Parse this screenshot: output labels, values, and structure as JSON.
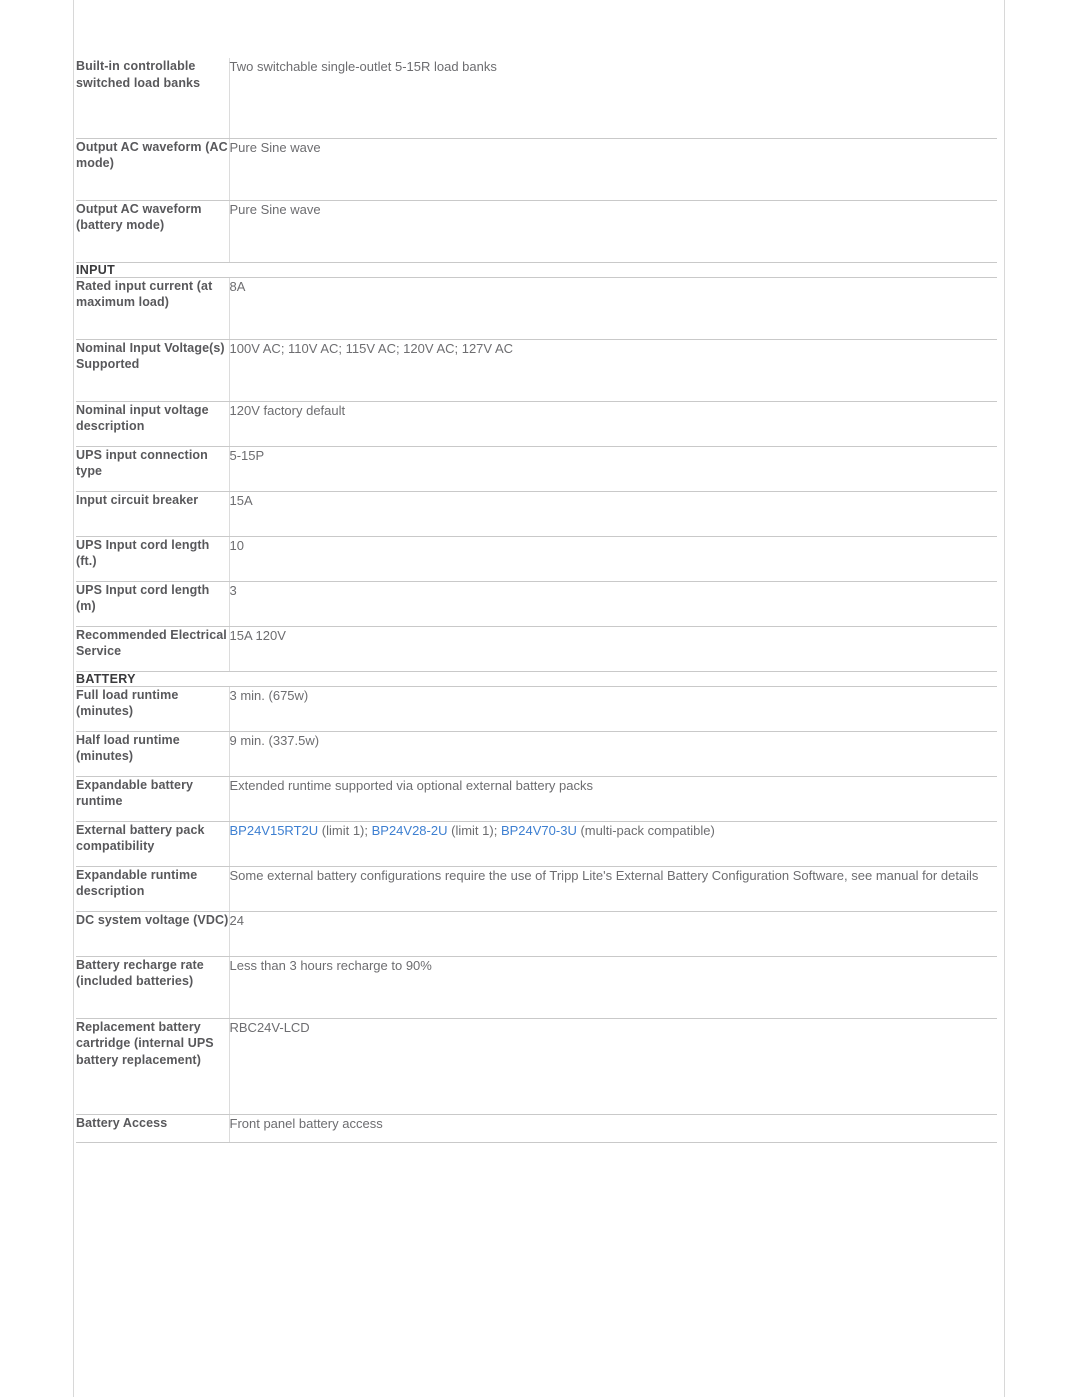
{
  "document": {
    "type": "product-specification-table",
    "accent_link_color": "#3d7fd1",
    "label_color": "#58585b",
    "value_color": "#6d6d70",
    "section_color": "#3a3a3c",
    "border_color": "#c9c9c9"
  },
  "rows": [
    {
      "kind": "data",
      "label": "Built-in controllable switched load banks",
      "value": "Two switchable single-outlet 5-15R load banks",
      "min_height": 80
    },
    {
      "kind": "data",
      "label": "Output AC waveform (AC mode)",
      "value": "Pure Sine wave",
      "min_height": 62
    },
    {
      "kind": "data",
      "label": "Output AC waveform (battery mode)",
      "value": "Pure Sine wave",
      "min_height": 62
    },
    {
      "kind": "section",
      "label": "INPUT"
    },
    {
      "kind": "data",
      "label": "Rated input current (at maximum load)",
      "value": "8A",
      "min_height": 62
    },
    {
      "kind": "data",
      "label": "Nominal Input Voltage(s) Supported",
      "value": "100V AC; 110V AC; 115V AC; 120V AC; 127V AC",
      "min_height": 62
    },
    {
      "kind": "data",
      "label": "Nominal input voltage description",
      "value": "120V factory default",
      "min_height": 45
    },
    {
      "kind": "data",
      "label": "UPS input connection type",
      "value": "5-15P",
      "min_height": 45
    },
    {
      "kind": "data",
      "label": "Input circuit breaker",
      "value": "15A",
      "min_height": 45
    },
    {
      "kind": "data",
      "label": "UPS Input cord length (ft.)",
      "value": "10",
      "min_height": 45
    },
    {
      "kind": "data",
      "label": "UPS Input cord length (m)",
      "value": "3",
      "min_height": 45
    },
    {
      "kind": "data",
      "label": "Recommended Electrical Service",
      "value": "15A 120V",
      "min_height": 45
    },
    {
      "kind": "section",
      "label": "BATTERY"
    },
    {
      "kind": "data",
      "label": "Full load runtime (minutes)",
      "value": "3 min. (675w)",
      "min_height": 45
    },
    {
      "kind": "data",
      "label": "Half load runtime (minutes)",
      "value": "9 min. (337.5w)",
      "min_height": 45
    },
    {
      "kind": "data",
      "label": "Expandable battery runtime",
      "value": "Extended runtime supported via optional external battery packs",
      "min_height": 45
    },
    {
      "kind": "data-links",
      "label": "External battery pack compatibility",
      "min_height": 45,
      "segments": [
        {
          "text": "BP24V15RT2U",
          "link": true
        },
        {
          "text": " (limit 1); ",
          "link": false
        },
        {
          "text": "BP24V28-2U",
          "link": true
        },
        {
          "text": " (limit 1); ",
          "link": false
        },
        {
          "text": "BP24V70-3U",
          "link": true
        },
        {
          "text": " (multi-pack compatible)",
          "link": false
        }
      ]
    },
    {
      "kind": "data",
      "label": "Expandable runtime description",
      "value": "Some external battery configurations require the use of Tripp Lite's External Battery Configuration Software, see manual for details",
      "min_height": 45
    },
    {
      "kind": "data",
      "label": "DC system voltage (VDC)",
      "value": "24",
      "min_height": 45
    },
    {
      "kind": "data",
      "label": "Battery recharge rate (included batteries)",
      "value": "Less than 3 hours recharge to 90%",
      "min_height": 62
    },
    {
      "kind": "data",
      "label": "Replacement battery cartridge (internal UPS battery replacement)",
      "value": "RBC24V-LCD",
      "min_height": 96
    },
    {
      "kind": "data",
      "label": "Battery Access",
      "value": "Front panel battery access",
      "min_height": 28
    }
  ]
}
